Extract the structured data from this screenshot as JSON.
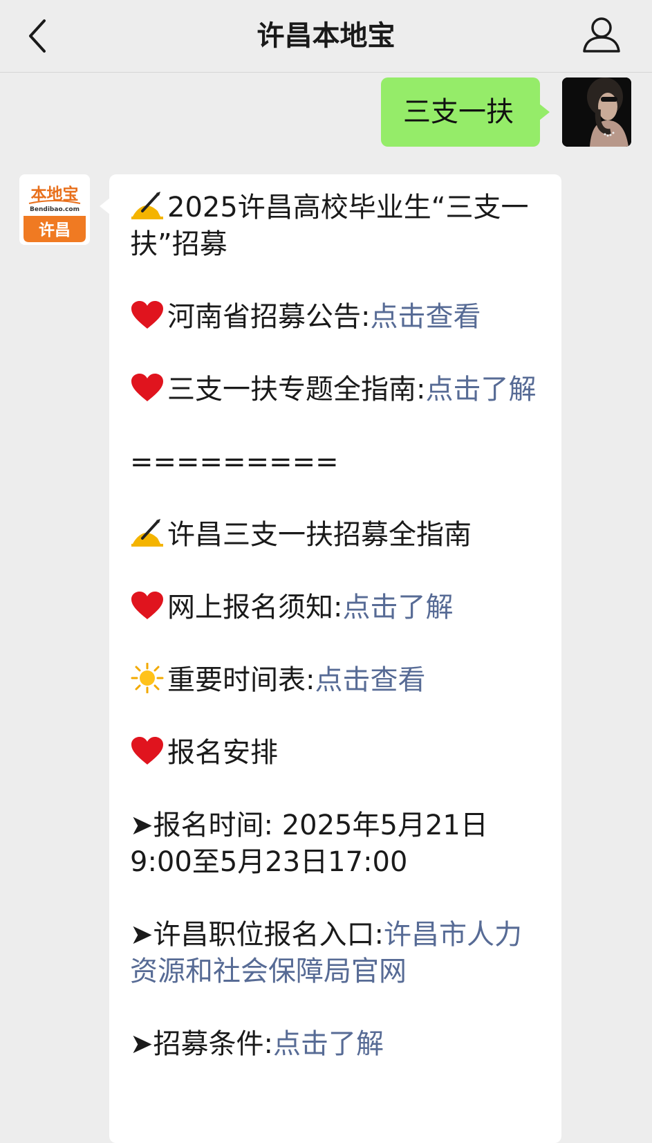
{
  "header": {
    "title": "许昌本地宝",
    "back_icon": "chevron-left-icon",
    "profile_icon": "person-icon"
  },
  "sent": {
    "text": "三支一扶"
  },
  "logo": {
    "top_text": "本地宝",
    "domain": "Bendibao.com",
    "city": "许昌"
  },
  "message": {
    "title": "2025许昌高校毕业生“三支一扶”招募",
    "items": [
      {
        "label": "河南省招募公告:",
        "link": "点击查看"
      },
      {
        "label": "三支一扶专题全指南:",
        "link": "点击了解"
      },
      {
        "separator": "========="
      },
      {
        "label": "许昌三支一扶招募全指南"
      },
      {
        "label": "网上报名须知:",
        "link": "点击了解"
      },
      {
        "label": "重要时间表:",
        "link": "点击查看"
      },
      {
        "label": "报名安排"
      },
      {
        "label": "➤报名时间: 2025年5月21日9:00至5月23日17:00"
      },
      {
        "label": "➤许昌职位报名入口:",
        "link": "许昌市人力资源和社会保障局官网"
      },
      {
        "label": "➤招募条件:",
        "link": "点击了解"
      }
    ]
  },
  "colors": {
    "background": "#ededed",
    "sent_bubble": "#95ec69",
    "link": "#576b95",
    "logo_orange": "#f07a22"
  }
}
